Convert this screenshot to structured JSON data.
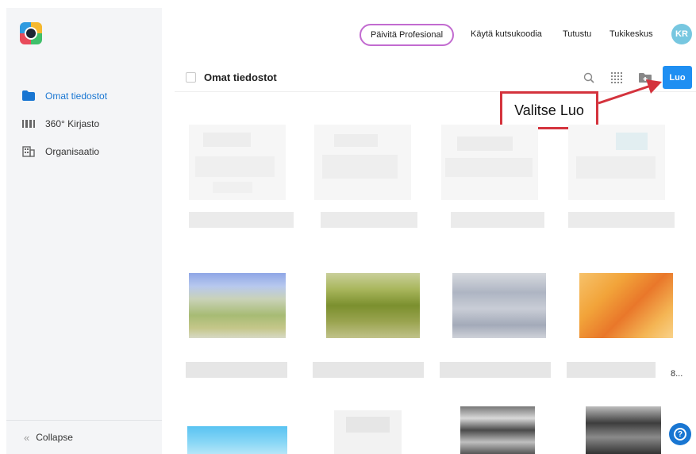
{
  "sidebar": {
    "items": [
      {
        "label": "Omat tiedostot",
        "icon": "folder-icon",
        "active": true
      },
      {
        "label": "360° Kirjasto",
        "icon": "library-icon",
        "active": false
      },
      {
        "label": "Organisaatio",
        "icon": "building-icon",
        "active": false
      }
    ],
    "collapse_label": "Collapse"
  },
  "topbar": {
    "upgrade_label": "Päivitä Profesional",
    "links": [
      "Käytä kutsukoodia",
      "Tutustu",
      "Tukikeskus"
    ],
    "avatar_initials": "KR"
  },
  "header": {
    "title": "Omat tiedostot",
    "create_label": "Luo"
  },
  "annotation": {
    "text": "Valitse Luo"
  },
  "grid": {
    "truncated_label": "8..."
  },
  "colors": {
    "accent": "#1f8ff2",
    "upgrade_border": "#c26bd0",
    "annotation": "#d4333d",
    "sidebar_bg": "#f4f5f7"
  }
}
